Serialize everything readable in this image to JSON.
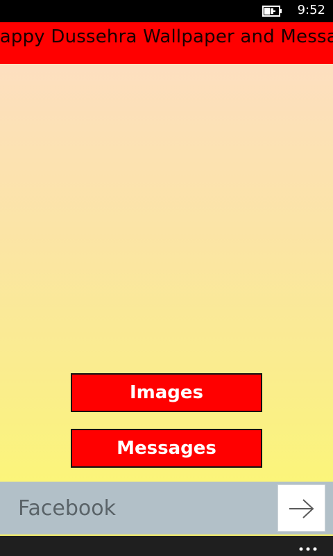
{
  "status_bar": {
    "time": "9:52",
    "battery_icon": "battery-charging-icon"
  },
  "header": {
    "title": "Happy Dussehra Wallpaper and Messages"
  },
  "main": {
    "buttons": [
      {
        "label": "Images"
      },
      {
        "label": "Messages"
      }
    ]
  },
  "facebook_bar": {
    "placeholder": "Facebook",
    "go_icon": "arrow-right-icon"
  },
  "app_bar": {
    "more_icon": "more-ellipsis-icon"
  },
  "colors": {
    "banner": "#ff0000",
    "button": "#ff0000",
    "gradient_top": "#fddfc0",
    "gradient_bottom": "#fbf57a",
    "facebook_bar": "#b2c0c8"
  }
}
